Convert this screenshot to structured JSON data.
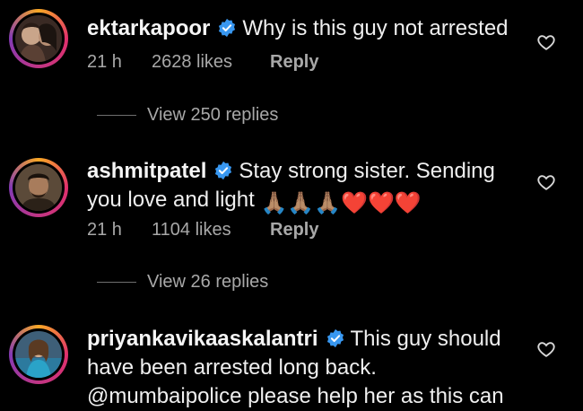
{
  "comments": [
    {
      "username": "ektarkapoor",
      "text": "Why is this guy not arrested",
      "time": "21 h",
      "likes": "2628 likes",
      "reply_label": "Reply",
      "view_replies": "View 250 replies"
    },
    {
      "username": "ashmitpatel",
      "text": "Stay strong sister. Sending you love and light",
      "emoji": "🙏🏽🙏🏽🙏🏽❤️❤️❤️",
      "time": "21 h",
      "likes": "1104 likes",
      "reply_label": "Reply",
      "view_replies": "View 26 replies"
    },
    {
      "username": "priyankavikaaskalantri",
      "text": "This guy should have been arrested long back. @mumbaipolice please help her as this can"
    }
  ],
  "colors": {
    "background": "#000000",
    "text": "#efefef",
    "muted": "#a8a8a8",
    "verified": "#3897f0"
  },
  "icons": {
    "verified": "verified-badge-icon",
    "like": "heart-outline-icon"
  }
}
